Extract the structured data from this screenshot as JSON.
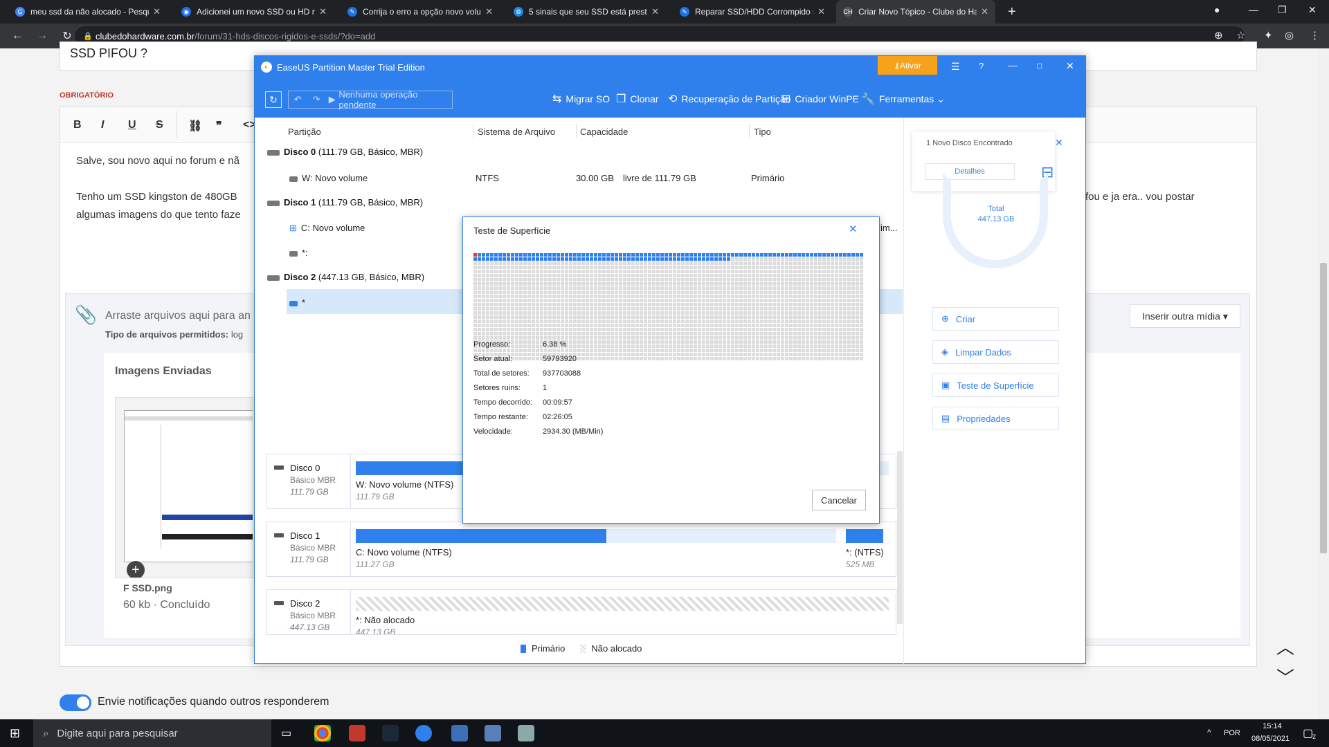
{
  "tabs": [
    {
      "title": "meu ssd da não alocado - Pesqu",
      "fav_color": "#4285f4",
      "fav_glyph": "G"
    },
    {
      "title": "Adicionei um novo SSD ou HD m",
      "fav_color": "#1a73e8",
      "fav_glyph": "◉"
    },
    {
      "title": "Corrija o erro a opção novo volu",
      "fav_color": "#1a73e8",
      "fav_glyph": "✎"
    },
    {
      "title": "5 sinais que seu SSD está preste",
      "fav_color": "#1e88e5",
      "fav_glyph": "⚙"
    },
    {
      "title": "Reparar SSD/HDD Corrompido s",
      "fav_color": "#1a73e8",
      "fav_glyph": "✎"
    },
    {
      "title": "Criar Novo Tópico - Clube do Ha",
      "fav_color": "#555",
      "fav_glyph": "CH"
    }
  ],
  "address": {
    "domain": "clubedohardware.com.br",
    "path": "/forum/31-hds-discos-rigidos-e-ssds/?do=add"
  },
  "page": {
    "title_snippet": "SSD PIFOU ?",
    "required": "OBRIGATÓRIO",
    "body_line1": "Salve, sou novo aqui no forum e nã",
    "body_line2": "Tenho um SSD kingston de 480GB",
    "body_line2_right": "fou e ja era.. vou postar",
    "body_line3": "algumas imagens do que tento faze",
    "drop_text": "Arraste arquivos aqui para an",
    "allowed_label": "Tipo de arquivos permitidos:",
    "allowed_value": "log",
    "insert_media": "Inserir outra mídia ▾",
    "sent_images": "Imagens Enviadas",
    "file_name": "F SSD.png",
    "file_meta": "60 kb · Concluído",
    "notify_text": "Envie notificações quando outros responderem"
  },
  "app": {
    "title": "EaseUS Partition Master Trial Edition",
    "activate": "Ativar",
    "pending": "Nenhuma operação pendente",
    "toolbar": [
      {
        "icon": "migrate-icon",
        "glyph": "⇆",
        "label": "Migrar SO"
      },
      {
        "icon": "clone-icon",
        "glyph": "❐",
        "label": "Clonar"
      },
      {
        "icon": "recovery-icon",
        "glyph": "⟲",
        "label": "Recuperação de Partição"
      },
      {
        "icon": "winpe-icon",
        "glyph": "⊞",
        "label": "Criador WinPE"
      },
      {
        "icon": "tools-icon",
        "glyph": "🔧",
        "label": "Ferramentas"
      }
    ],
    "columns": {
      "partition": "Partição",
      "fs": "Sistema de Arquivo",
      "capacity": "Capacidade",
      "type": "Tipo"
    },
    "disks": [
      {
        "name": "Disco 0",
        "info": "(111.79 GB, Básico, MBR)"
      },
      {
        "name": "Disco 1",
        "info": "(111.79 GB, Básico, MBR)"
      },
      {
        "name": "Disco 2",
        "info": "(447.13 GB, Básico, MBR)"
      }
    ],
    "partitions": [
      {
        "name": "W: Novo volume",
        "fs": "NTFS",
        "capacity": "30.00 GB",
        "free": "livre de 111.79 GB",
        "type": "Primário"
      },
      {
        "name": "C: Novo volume",
        "fs": "",
        "capacity": "",
        "free": "",
        "type": "im..."
      },
      {
        "name": "*:",
        "fs": "",
        "capacity": "",
        "free": "",
        "type": ""
      },
      {
        "name": "*",
        "fs": "",
        "capacity": "",
        "free": "",
        "type": ""
      }
    ],
    "new_disk": {
      "count": "1",
      "text": "Novo Disco Encontrado",
      "details": "Detalhes"
    },
    "donut": {
      "label": "Total",
      "value": "447.13 GB"
    },
    "actions": [
      {
        "icon": "create-icon",
        "glyph": "⊕",
        "label": "Criar"
      },
      {
        "icon": "wipe-icon",
        "glyph": "◈",
        "label": "Limpar Dados"
      },
      {
        "icon": "surface-test-icon",
        "glyph": "▣",
        "label": "Teste de Superfície"
      },
      {
        "icon": "properties-icon",
        "glyph": "▤",
        "label": "Propriedades"
      }
    ],
    "disk_maps": [
      {
        "name": "Disco 0",
        "kind": "Básico MBR",
        "size": "111.79 GB",
        "parts": [
          {
            "label": "W: Novo volume (NTFS)",
            "size": "111.79 GB"
          }
        ]
      },
      {
        "name": "Disco 1",
        "kind": "Básico MBR",
        "size": "111.79 GB",
        "parts": [
          {
            "label": "C: Novo volume (NTFS)",
            "size": "111.27 GB"
          },
          {
            "label": "*: (NTFS)",
            "size": "525 MB"
          }
        ]
      },
      {
        "name": "Disco 2",
        "kind": "Básico MBR",
        "size": "447.13 GB",
        "parts": [
          {
            "label": "*: Não alocado",
            "size": "447.13 GB"
          }
        ]
      }
    ],
    "legend": {
      "primary": "Primário",
      "unallocated": "Não alocado"
    }
  },
  "dialog": {
    "title": "Teste de Superfície",
    "progress_fraction": 0.0638,
    "stats": [
      {
        "label": "Progresso:",
        "value": "6.38 %"
      },
      {
        "label": "Setor atual:",
        "value": "59793920"
      },
      {
        "label": "Total de setores:",
        "value": "937703088"
      },
      {
        "label": "Setores ruins:",
        "value": "1"
      },
      {
        "label": "Tempo decorrido:",
        "value": "00:09:57"
      },
      {
        "label": "Tempo restante:",
        "value": "02:26:05"
      },
      {
        "label": "Velocidade:",
        "value": "2934.30 (MB/Min)"
      }
    ],
    "cancel": "Cancelar"
  },
  "taskbar": {
    "search": "Digite aqui para pesquisar",
    "lang": "POR",
    "time": "15:14",
    "date": "08/05/2021",
    "notifications": "2"
  }
}
